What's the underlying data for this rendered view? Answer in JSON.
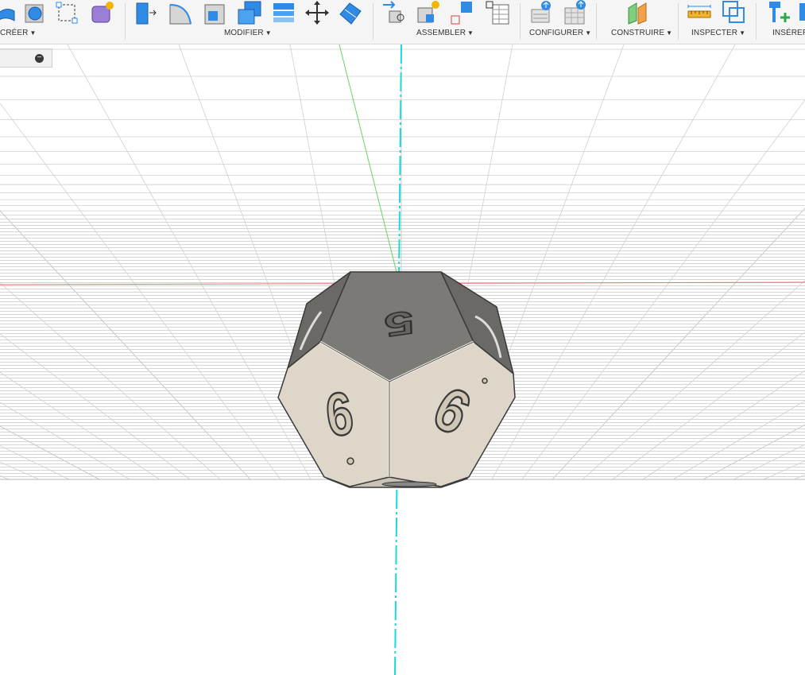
{
  "toolbar": {
    "groups": [
      {
        "id": "creer",
        "label": "CRÉER",
        "icons": [
          "extrude-arc-icon",
          "revolve-icon",
          "sketch-point-icon",
          "form-icon"
        ]
      },
      {
        "id": "modifier",
        "label": "MODIFIER",
        "icons": [
          "press-pull-icon",
          "fillet-icon",
          "shell-icon",
          "combine-icon",
          "offset-face-icon",
          "move-icon",
          "split-body-icon"
        ]
      },
      {
        "id": "assembler",
        "label": "ASSEMBLER",
        "icons": [
          "joint-icon",
          "new-component-icon",
          "as-built-joint-icon",
          "bom-table-icon"
        ]
      },
      {
        "id": "configurer",
        "label": "CONFIGURER",
        "icons": [
          "configure-parameter-icon",
          "configure-table-icon"
        ]
      },
      {
        "id": "construire",
        "label": "CONSTRUIRE",
        "icons": [
          "construction-plane-icon"
        ]
      },
      {
        "id": "inspecter",
        "label": "INSPECTER",
        "icons": [
          "measure-icon",
          "interference-icon"
        ]
      },
      {
        "id": "inserer",
        "label": "INSÉRER",
        "icons": [
          "insert-mesh-icon"
        ]
      }
    ]
  },
  "browser": {
    "collapse_symbol": "−"
  },
  "model": {
    "type": "dodecahedron-die",
    "visible_face_numbers": {
      "top": "5",
      "front_left": "6",
      "front_right": "6"
    }
  },
  "colors": {
    "toolbar_bg": "#f5f5f5",
    "icon_blue": "#2f8be5",
    "icon_gray": "#9b9b9b",
    "axis_x": "#e87070",
    "axis_y": "#5fd95f",
    "axis_z": "#19d9d9",
    "face_light": "#ded6c8",
    "face_dark": "#7c7a77",
    "grid": "#cfcfcf"
  }
}
